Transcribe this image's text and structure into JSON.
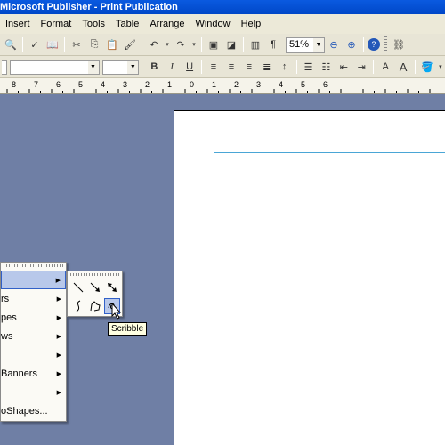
{
  "window": {
    "title": "Microsoft Publisher - Print Publication"
  },
  "menu": {
    "items": [
      "Insert",
      "Format",
      "Tools",
      "Table",
      "Arrange",
      "Window",
      "Help"
    ]
  },
  "toolbar": {
    "zoom_value": "51%"
  },
  "ruler": {
    "labels": [
      "8",
      "7",
      "6",
      "5",
      "4",
      "3",
      "2",
      "1",
      "0",
      "1",
      "2",
      "3",
      "4",
      "5",
      "6"
    ]
  },
  "autoshapes_menu": {
    "items": [
      {
        "label": "",
        "has_submenu": true,
        "selected": true
      },
      {
        "label": "rs",
        "has_submenu": true
      },
      {
        "label": "pes",
        "has_submenu": true
      },
      {
        "label": "ws",
        "has_submenu": true
      },
      {
        "label": "",
        "has_submenu": true
      },
      {
        "label": "Banners",
        "has_submenu": true
      },
      {
        "label": "",
        "has_submenu": true
      },
      {
        "label": "oShapes...",
        "has_submenu": false
      }
    ]
  },
  "lines_submenu": {
    "tools": [
      "line-icon",
      "arrow-icon",
      "double-arrow-icon",
      "curve-icon",
      "freeform-icon",
      "scribble-icon"
    ],
    "tooltip": "Scribble"
  },
  "colors": {
    "titlebar": "#0a5ae0",
    "workspace": "#6f7fa5",
    "selection": "#b8c8ea",
    "guide": "#4aa6d6"
  }
}
